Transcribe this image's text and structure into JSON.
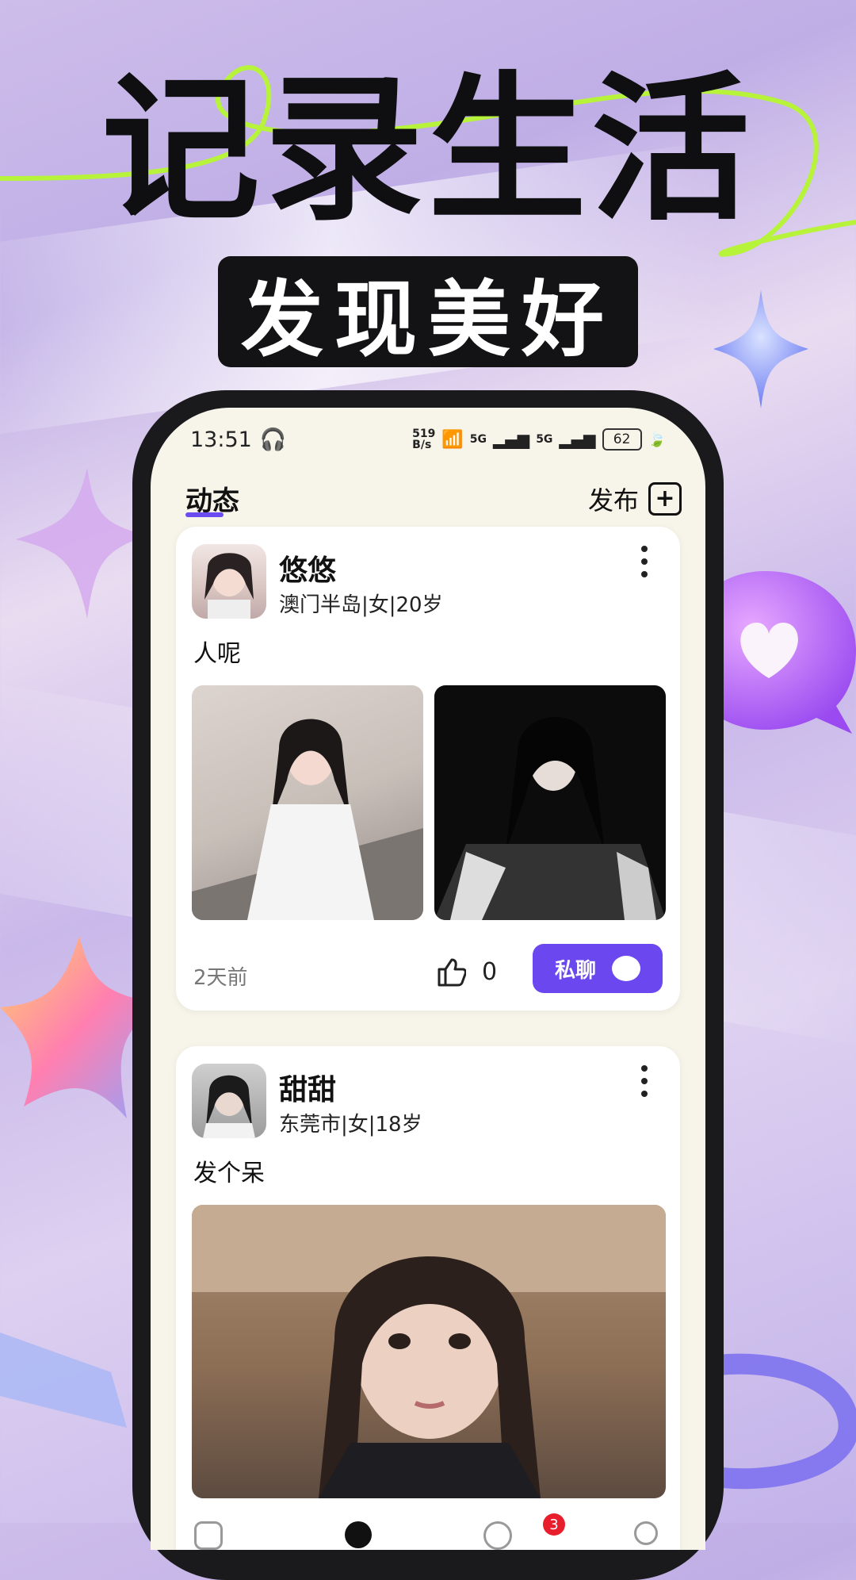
{
  "hero": {
    "headline": "记录生活",
    "subline": "发现美好"
  },
  "status_bar": {
    "time": "13:51",
    "net_speed_top": "519",
    "net_speed_bottom": "B/s",
    "signal1": "5G",
    "signal2": "5G",
    "battery": "62"
  },
  "top_nav": {
    "active_tab": "动态",
    "publish_label": "发布"
  },
  "posts": [
    {
      "name": "悠悠",
      "meta": "澳门半岛|女|20岁",
      "text": "人呢",
      "time": "2天前",
      "likes": "0",
      "chat_label": "私聊"
    },
    {
      "name": "甜甜",
      "meta": "东莞市|女|18岁",
      "text": "发个呆"
    }
  ],
  "bottom_nav": {
    "messages_badge": "3"
  },
  "colors": {
    "accent": "#6a47ef",
    "headline": "#0f0f12",
    "lime": "#b6f33a",
    "badge": "#e81e2c"
  }
}
